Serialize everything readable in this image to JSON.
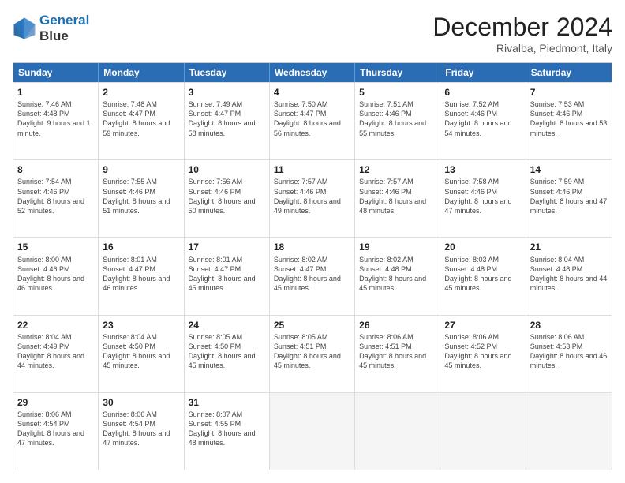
{
  "header": {
    "logo_line1": "General",
    "logo_line2": "Blue",
    "month": "December 2024",
    "location": "Rivalba, Piedmont, Italy"
  },
  "days_of_week": [
    "Sunday",
    "Monday",
    "Tuesday",
    "Wednesday",
    "Thursday",
    "Friday",
    "Saturday"
  ],
  "weeks": [
    [
      {
        "day": "1",
        "info": "Sunrise: 7:46 AM\nSunset: 4:48 PM\nDaylight: 9 hours and 1 minute."
      },
      {
        "day": "2",
        "info": "Sunrise: 7:48 AM\nSunset: 4:47 PM\nDaylight: 8 hours and 59 minutes."
      },
      {
        "day": "3",
        "info": "Sunrise: 7:49 AM\nSunset: 4:47 PM\nDaylight: 8 hours and 58 minutes."
      },
      {
        "day": "4",
        "info": "Sunrise: 7:50 AM\nSunset: 4:47 PM\nDaylight: 8 hours and 56 minutes."
      },
      {
        "day": "5",
        "info": "Sunrise: 7:51 AM\nSunset: 4:46 PM\nDaylight: 8 hours and 55 minutes."
      },
      {
        "day": "6",
        "info": "Sunrise: 7:52 AM\nSunset: 4:46 PM\nDaylight: 8 hours and 54 minutes."
      },
      {
        "day": "7",
        "info": "Sunrise: 7:53 AM\nSunset: 4:46 PM\nDaylight: 8 hours and 53 minutes."
      }
    ],
    [
      {
        "day": "8",
        "info": "Sunrise: 7:54 AM\nSunset: 4:46 PM\nDaylight: 8 hours and 52 minutes."
      },
      {
        "day": "9",
        "info": "Sunrise: 7:55 AM\nSunset: 4:46 PM\nDaylight: 8 hours and 51 minutes."
      },
      {
        "day": "10",
        "info": "Sunrise: 7:56 AM\nSunset: 4:46 PM\nDaylight: 8 hours and 50 minutes."
      },
      {
        "day": "11",
        "info": "Sunrise: 7:57 AM\nSunset: 4:46 PM\nDaylight: 8 hours and 49 minutes."
      },
      {
        "day": "12",
        "info": "Sunrise: 7:57 AM\nSunset: 4:46 PM\nDaylight: 8 hours and 48 minutes."
      },
      {
        "day": "13",
        "info": "Sunrise: 7:58 AM\nSunset: 4:46 PM\nDaylight: 8 hours and 47 minutes."
      },
      {
        "day": "14",
        "info": "Sunrise: 7:59 AM\nSunset: 4:46 PM\nDaylight: 8 hours and 47 minutes."
      }
    ],
    [
      {
        "day": "15",
        "info": "Sunrise: 8:00 AM\nSunset: 4:46 PM\nDaylight: 8 hours and 46 minutes."
      },
      {
        "day": "16",
        "info": "Sunrise: 8:01 AM\nSunset: 4:47 PM\nDaylight: 8 hours and 46 minutes."
      },
      {
        "day": "17",
        "info": "Sunrise: 8:01 AM\nSunset: 4:47 PM\nDaylight: 8 hours and 45 minutes."
      },
      {
        "day": "18",
        "info": "Sunrise: 8:02 AM\nSunset: 4:47 PM\nDaylight: 8 hours and 45 minutes."
      },
      {
        "day": "19",
        "info": "Sunrise: 8:02 AM\nSunset: 4:48 PM\nDaylight: 8 hours and 45 minutes."
      },
      {
        "day": "20",
        "info": "Sunrise: 8:03 AM\nSunset: 4:48 PM\nDaylight: 8 hours and 45 minutes."
      },
      {
        "day": "21",
        "info": "Sunrise: 8:04 AM\nSunset: 4:48 PM\nDaylight: 8 hours and 44 minutes."
      }
    ],
    [
      {
        "day": "22",
        "info": "Sunrise: 8:04 AM\nSunset: 4:49 PM\nDaylight: 8 hours and 44 minutes."
      },
      {
        "day": "23",
        "info": "Sunrise: 8:04 AM\nSunset: 4:50 PM\nDaylight: 8 hours and 45 minutes."
      },
      {
        "day": "24",
        "info": "Sunrise: 8:05 AM\nSunset: 4:50 PM\nDaylight: 8 hours and 45 minutes."
      },
      {
        "day": "25",
        "info": "Sunrise: 8:05 AM\nSunset: 4:51 PM\nDaylight: 8 hours and 45 minutes."
      },
      {
        "day": "26",
        "info": "Sunrise: 8:06 AM\nSunset: 4:51 PM\nDaylight: 8 hours and 45 minutes."
      },
      {
        "day": "27",
        "info": "Sunrise: 8:06 AM\nSunset: 4:52 PM\nDaylight: 8 hours and 45 minutes."
      },
      {
        "day": "28",
        "info": "Sunrise: 8:06 AM\nSunset: 4:53 PM\nDaylight: 8 hours and 46 minutes."
      }
    ],
    [
      {
        "day": "29",
        "info": "Sunrise: 8:06 AM\nSunset: 4:54 PM\nDaylight: 8 hours and 47 minutes."
      },
      {
        "day": "30",
        "info": "Sunrise: 8:06 AM\nSunset: 4:54 PM\nDaylight: 8 hours and 47 minutes."
      },
      {
        "day": "31",
        "info": "Sunrise: 8:07 AM\nSunset: 4:55 PM\nDaylight: 8 hours and 48 minutes."
      },
      {
        "day": "",
        "info": ""
      },
      {
        "day": "",
        "info": ""
      },
      {
        "day": "",
        "info": ""
      },
      {
        "day": "",
        "info": ""
      }
    ]
  ]
}
